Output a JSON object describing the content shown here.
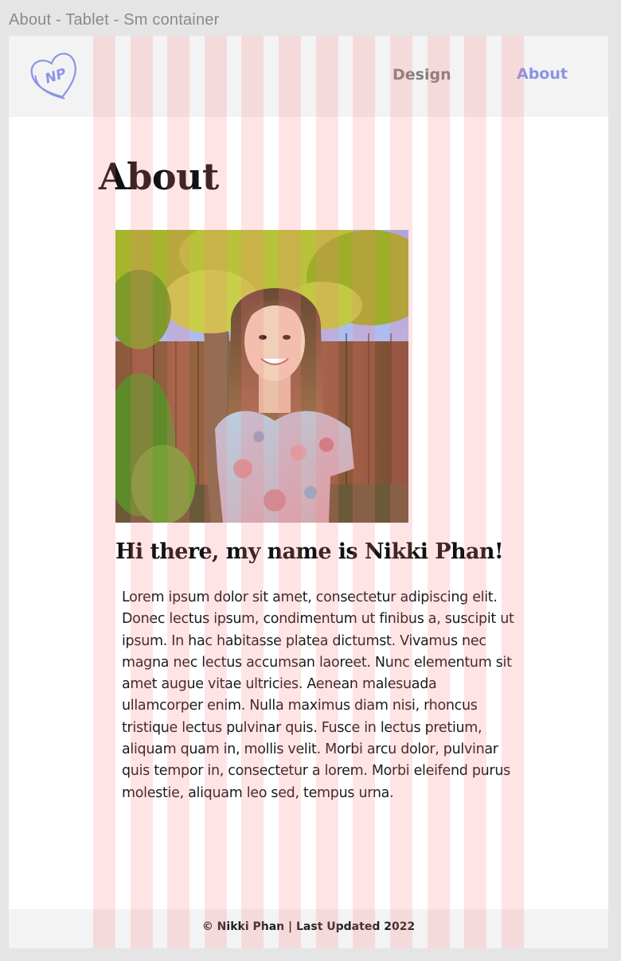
{
  "frame": {
    "label": "About - Tablet - Sm container"
  },
  "header": {
    "logo_text": "NP",
    "nav": [
      {
        "label": "Design",
        "active": false
      },
      {
        "label": "About",
        "active": true
      }
    ]
  },
  "main": {
    "title": "About",
    "photo_alt": "Portrait photo of Nikki Phan",
    "greeting": "Hi there, my name is Nikki Phan!",
    "bio": "Lorem ipsum dolor sit amet, consectetur adipiscing elit. Donec lectus ipsum, condimentum ut finibus a, suscipit ut ipsum. In hac habitasse platea dictumst. Vivamus nec magna nec lectus accumsan laoreet. Nunc elementum sit amet augue vitae ultricies. Aenean malesuada ullamcorper enim. Nulla maximus diam nisi, rhoncus tristique lectus pulvinar quis. Fusce in lectus pretium, aliquam quam in, mollis velit. Morbi arcu dolor, pulvinar quis tempor in, consectetur a lorem. Morbi eleifend purus molestie, aliquam leo sed, tempus urna."
  },
  "footer": {
    "text": "© Nikki Phan | Last Updated 2022"
  },
  "colors": {
    "accent": "#8b93e6",
    "nav_inactive": "#7f7f7f",
    "header_bg": "#f3f3f3",
    "grid_overlay": "#ffd6d9"
  }
}
